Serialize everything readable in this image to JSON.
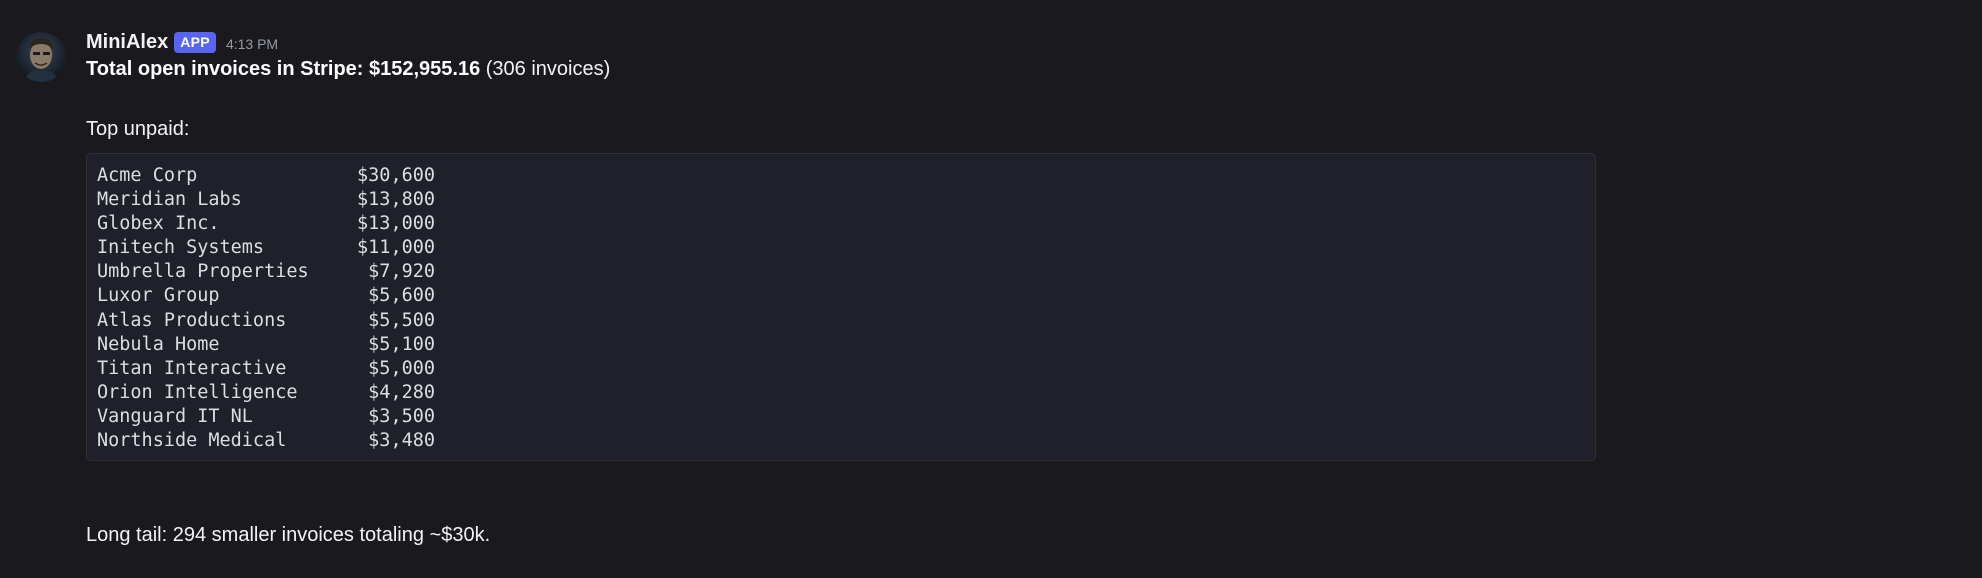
{
  "message": {
    "username": "MiniAlex",
    "badge": "APP",
    "timestamp": "4:13 PM",
    "summary_bold": "Total open invoices in Stripe: $152,955.16",
    "summary_rest": " (306 invoices)",
    "top_unpaid_label": "Top unpaid:",
    "invoices": [
      {
        "name": "Acme Corp",
        "amount": "$30,600"
      },
      {
        "name": "Meridian Labs",
        "amount": "$13,800"
      },
      {
        "name": "Globex Inc.",
        "amount": "$13,000"
      },
      {
        "name": "Initech Systems",
        "amount": "$11,000"
      },
      {
        "name": "Umbrella Properties",
        "amount": "$7,920"
      },
      {
        "name": "Luxor Group",
        "amount": "$5,600"
      },
      {
        "name": "Atlas Productions",
        "amount": "$5,500"
      },
      {
        "name": "Nebula Home",
        "amount": "$5,100"
      },
      {
        "name": "Titan Interactive",
        "amount": "$5,000"
      },
      {
        "name": "Orion Intelligence",
        "amount": "$4,280"
      },
      {
        "name": "Vanguard IT NL",
        "amount": "$3,500"
      },
      {
        "name": "Northside Medical",
        "amount": "$3,480"
      }
    ],
    "long_tail": "Long tail: 294 smaller invoices totaling ~$30k."
  },
  "colors": {
    "background": "#1a1a1e",
    "badge": "#5865f2",
    "code_background": "#1f2029"
  }
}
